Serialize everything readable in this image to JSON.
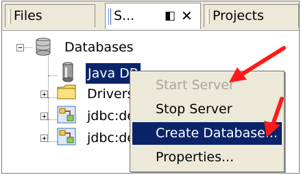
{
  "tabs": [
    {
      "label": "Files"
    },
    {
      "label": "S..."
    },
    {
      "label": "Projects"
    }
  ],
  "tab_controls": {
    "minimize_glyph": "◧",
    "close_glyph": "✕"
  },
  "tree": {
    "root": {
      "label": "Databases",
      "expander": "−"
    },
    "children": [
      {
        "label": "Java DB",
        "selected": true
      },
      {
        "label": "Drivers",
        "expander": "+"
      },
      {
        "label": "jdbc:de",
        "expander": "+"
      },
      {
        "label": "jdbc:de",
        "expander": "+"
      }
    ]
  },
  "context_menu": {
    "items": [
      {
        "label": "Start Server",
        "enabled": false
      },
      {
        "label": "Stop Server",
        "enabled": true
      },
      {
        "label": "Create Database...",
        "enabled": true,
        "highlighted": true
      },
      {
        "label": "Properties...",
        "enabled": true
      }
    ]
  },
  "colors": {
    "selection": "#0a246a",
    "annotation_arrow": "#ff1a1a",
    "menu_bg": "#ece9d8"
  }
}
